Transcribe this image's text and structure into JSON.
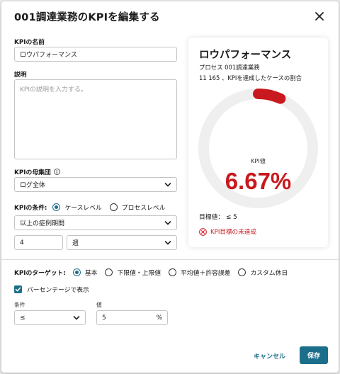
{
  "dialog": {
    "title": "001調達業務のKPIを編集する",
    "close_icon": "close-icon"
  },
  "form": {
    "name_label": "KPIの名前",
    "name_value": "ロウパフォーマンス",
    "description_label": "説明",
    "description_placeholder": "KPIの説明を入力する。",
    "population_label": "KPIの母集団",
    "population_info_icon": "info-icon",
    "population_value": "ログ全体",
    "condition_label": "KPIの条件:",
    "condition_options": [
      {
        "label": "ケースレベル",
        "selected": true
      },
      {
        "label": "プロセスレベル",
        "selected": false
      }
    ],
    "condition_select_value": "以上の症例期間",
    "duration_number": "4",
    "duration_unit": "週",
    "target_label": "KPIのターゲット:",
    "target_options": [
      {
        "label": "基本",
        "selected": true
      },
      {
        "label": "下限値・上限値",
        "selected": false
      },
      {
        "label": "平均値＋許容誤差",
        "selected": false
      },
      {
        "label": "カスタム休日",
        "selected": false
      }
    ],
    "percentage_checkbox_label": "パーセンテージで表示",
    "percentage_checked": true,
    "operator_label": "条件",
    "operator_value": "≤",
    "value_label": "値",
    "value_value": "5",
    "value_unit": "%"
  },
  "preview": {
    "title": "ロウパフォーマンス",
    "process_line": "プロセス 001調達業務",
    "cases_line": "11 165 、KPIを達成したケースの割合",
    "kpi_label": "KPI値",
    "kpi_value": "6.67%",
    "kpi_fraction": 0.0667,
    "target_text": "目標値： ≤ 5",
    "status_text": "KPI目標の未達成",
    "status_icon": "error-circle-icon"
  },
  "footer": {
    "cancel_label": "キャンセル",
    "save_label": "保存"
  },
  "colors": {
    "accent": "#1c6f8a",
    "error": "#c8191e",
    "gauge_track": "#efefef"
  }
}
